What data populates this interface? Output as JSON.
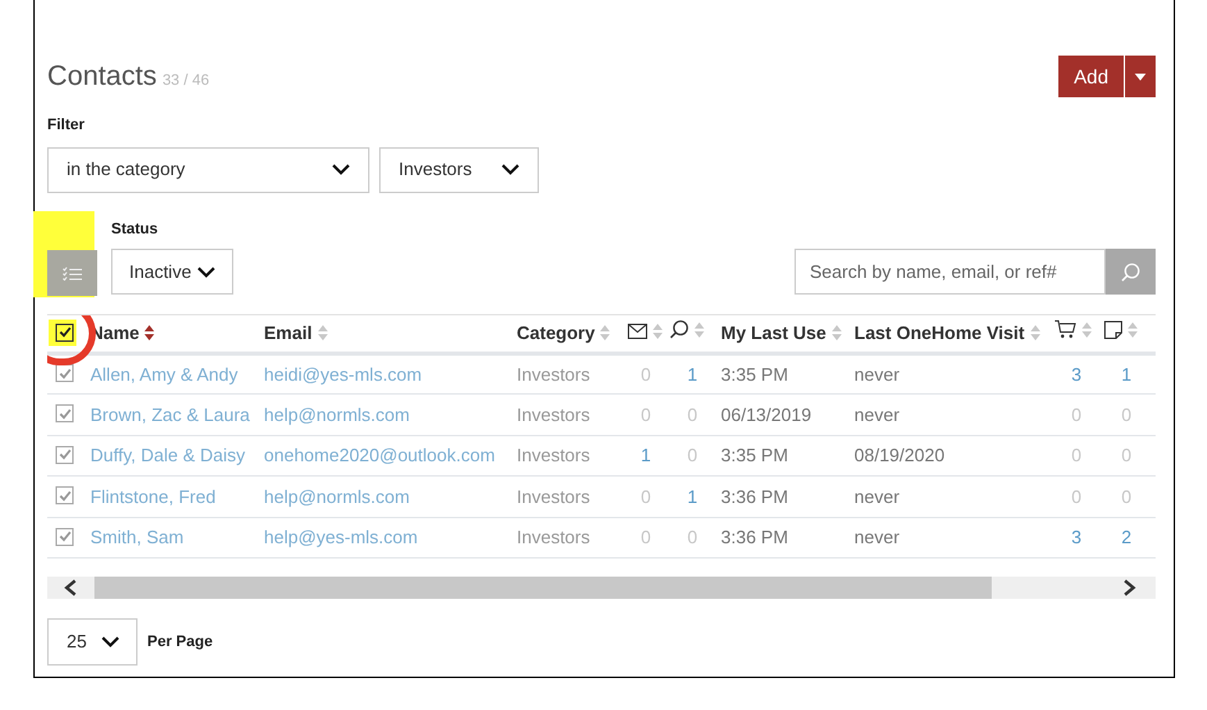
{
  "header": {
    "title": "Contacts",
    "count": "33 / 46",
    "add_button": "Add"
  },
  "filter": {
    "label": "Filter",
    "condition": "in the category",
    "value": "Investors"
  },
  "status": {
    "label": "Status",
    "value": "Inactive"
  },
  "search": {
    "placeholder": "Search by name, email, or ref#"
  },
  "table": {
    "all_checked": true,
    "columns": [
      {
        "label": "Name",
        "kind": "text",
        "sorted": true
      },
      {
        "label": "Email",
        "kind": "text",
        "sorted": false
      },
      {
        "label": "Category",
        "kind": "text",
        "sorted": false
      },
      {
        "kind": "mail-icon",
        "sorted": false
      },
      {
        "kind": "search-icon",
        "sorted": false
      },
      {
        "label": "My Last Use",
        "kind": "text",
        "sorted": false
      },
      {
        "label": "Last OneHome Visit",
        "kind": "text",
        "sorted": false
      },
      {
        "kind": "cart-icon",
        "sorted": false
      },
      {
        "kind": "note-icon",
        "sorted": false
      }
    ],
    "rows": [
      {
        "checked": true,
        "name": "Allen, Amy & Andy",
        "email": "heidi@yes-mls.com",
        "category": "Investors",
        "emails": {
          "value": "0",
          "active": false
        },
        "searches": {
          "value": "1",
          "active": true
        },
        "last_use": "3:35 PM",
        "last_visit": "never",
        "carts": {
          "value": "3",
          "active": true
        },
        "notes": {
          "value": "1",
          "active": true
        }
      },
      {
        "checked": true,
        "name": "Brown, Zac & Laura",
        "email": "help@normls.com",
        "category": "Investors",
        "emails": {
          "value": "0",
          "active": false
        },
        "searches": {
          "value": "0",
          "active": false
        },
        "last_use": "06/13/2019",
        "last_visit": "never",
        "carts": {
          "value": "0",
          "active": false
        },
        "notes": {
          "value": "0",
          "active": false
        }
      },
      {
        "checked": true,
        "name": "Duffy, Dale & Daisy",
        "email": "onehome2020@outlook.com",
        "category": "Investors",
        "emails": {
          "value": "1",
          "active": true
        },
        "searches": {
          "value": "0",
          "active": false
        },
        "last_use": "3:35 PM",
        "last_visit": "08/19/2020",
        "carts": {
          "value": "0",
          "active": false
        },
        "notes": {
          "value": "0",
          "active": false
        }
      },
      {
        "checked": true,
        "name": "Flintstone, Fred",
        "email": "help@normls.com",
        "category": "Investors",
        "emails": {
          "value": "0",
          "active": false
        },
        "searches": {
          "value": "1",
          "active": true
        },
        "last_use": "3:36 PM",
        "last_visit": "never",
        "carts": {
          "value": "0",
          "active": false
        },
        "notes": {
          "value": "0",
          "active": false
        }
      },
      {
        "checked": true,
        "name": "Smith, Sam",
        "email": "help@yes-mls.com",
        "category": "Investors",
        "emails": {
          "value": "0",
          "active": false
        },
        "searches": {
          "value": "0",
          "active": false
        },
        "last_use": "3:36 PM",
        "last_visit": "never",
        "carts": {
          "value": "3",
          "active": true
        },
        "notes": {
          "value": "2",
          "active": true
        }
      }
    ]
  },
  "pagination": {
    "per_page": "25",
    "label": "Per Page"
  }
}
